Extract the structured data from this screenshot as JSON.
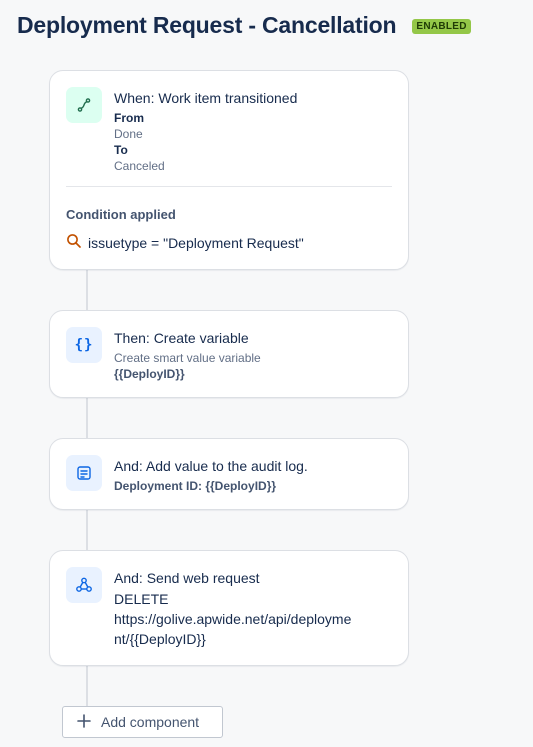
{
  "header": {
    "title": "Deployment Request - Cancellation",
    "status_badge": "ENABLED"
  },
  "trigger": {
    "icon": "transition-icon",
    "title": "When: Work item transitioned",
    "from_label": "From",
    "from_value": "Done",
    "to_label": "To",
    "to_value": "Canceled",
    "condition_title": "Condition applied",
    "condition_icon": "search-icon",
    "condition_text": "issuetype = \"Deployment Request\""
  },
  "steps": [
    {
      "icon": "braces-icon",
      "title": "Then: Create variable",
      "subtitle": "Create smart value variable",
      "detail": "{{DeployID}}"
    },
    {
      "icon": "log-icon",
      "title": "And: Add value to the audit log.",
      "detail": "Deployment ID: {{DeployID}}"
    },
    {
      "icon": "webhook-icon",
      "title": "And: Send web request",
      "method": "DELETE",
      "url_line1": "https://golive.apwide.net/api/deployme",
      "url_line2": "nt/{{DeployID}}"
    }
  ],
  "add_component": {
    "icon": "plus-icon",
    "label": "Add component"
  },
  "colors": {
    "badge": "#94c748",
    "trigger_icon_bg": "#dcfff1",
    "action_icon_bg": "#e9f2ff",
    "connector": "#dcdfe4"
  }
}
